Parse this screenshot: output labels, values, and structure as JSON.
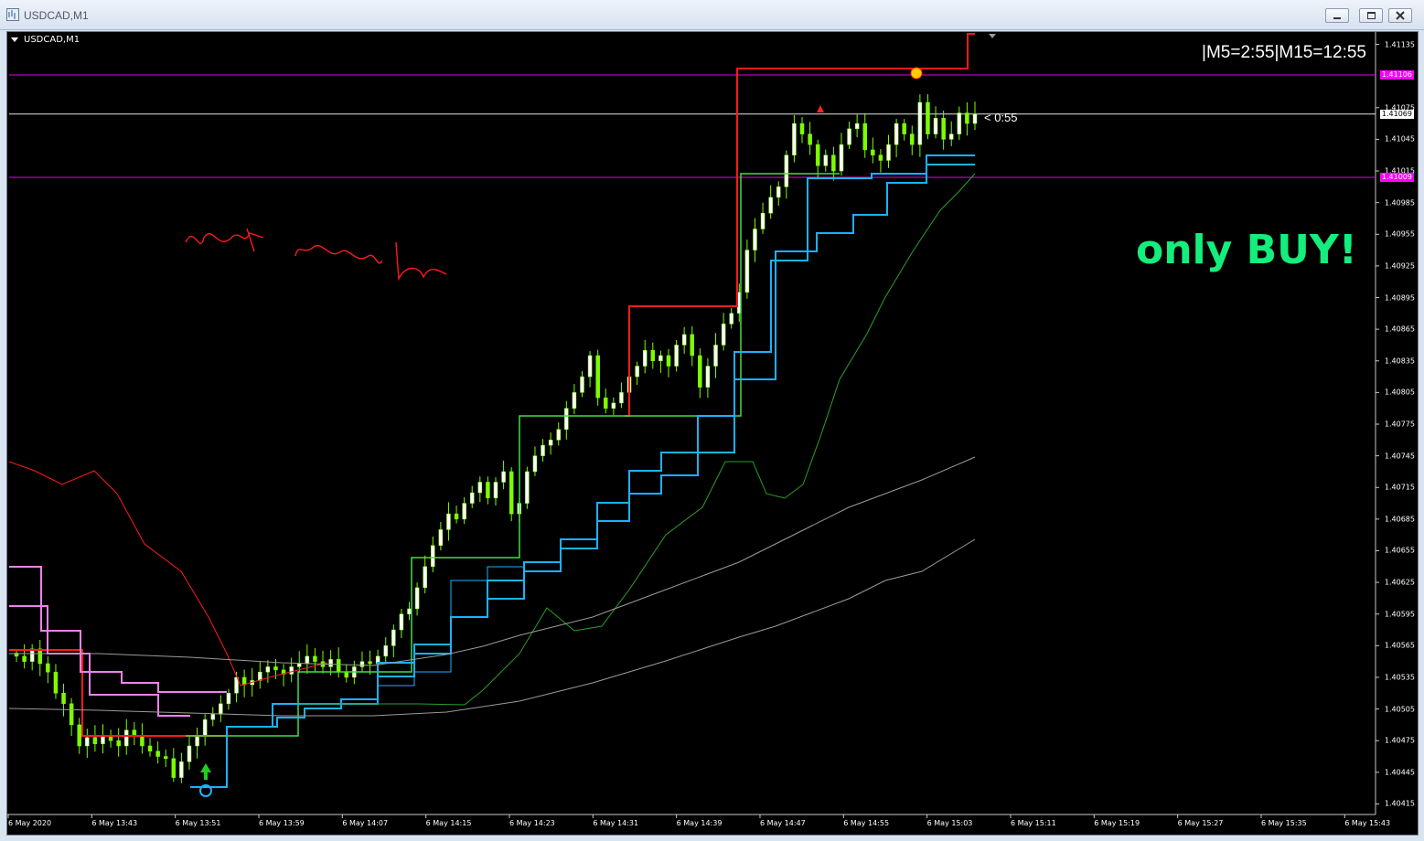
{
  "window": {
    "title": "USDCAD,M1",
    "symbol_label": "USDCAD,M1"
  },
  "overlay": {
    "timer": "|M5=2:55|M15=12:55",
    "countdown": "< 0:55",
    "signal_text": "only BUY!",
    "handwritten_note": "next 15min bar"
  },
  "price_axis": {
    "ticks": [
      "1.41135",
      "1.41075",
      "1.41045",
      "1.41015",
      "1.40985",
      "1.40955",
      "1.40925",
      "1.40895",
      "1.40865",
      "1.40835",
      "1.40805",
      "1.40775",
      "1.40745",
      "1.40715",
      "1.40685",
      "1.40655",
      "1.40625",
      "1.40595",
      "1.40565",
      "1.40535",
      "1.40505",
      "1.40475",
      "1.40445",
      "1.40415"
    ],
    "marked_levels": [
      {
        "label": "1.41106",
        "color": "#ff00ff"
      },
      {
        "label": "1.41069",
        "color": "#ffffff"
      },
      {
        "label": "1.41009",
        "color": "#ff00ff"
      }
    ]
  },
  "time_axis": {
    "ticks": [
      "6 May 2020",
      "6 May 13:43",
      "6 May 13:51",
      "6 May 13:59",
      "6 May 14:07",
      "6 May 14:15",
      "6 May 14:23",
      "6 May 14:31",
      "6 May 14:39",
      "6 May 14:47",
      "6 May 14:55",
      "6 May 15:03",
      "6 May 15:11",
      "6 May 15:19",
      "6 May 15:27",
      "6 May 15:35",
      "6 May 15:43"
    ]
  },
  "colors": {
    "candle_bull": "#ffffff",
    "candle_bear": "#7cfc00",
    "magenta_level": "#ff00ff",
    "red_line": "#ff1a1a",
    "blue_line": "#1ab2ff",
    "green_line": "#44dd44",
    "buy_text": "#13ee7c"
  },
  "chart_data": {
    "type": "candlestick",
    "symbol": "USDCAD",
    "timeframe": "M1",
    "y_range": [
      1.40405,
      1.41145
    ],
    "closes": [
      1.40555,
      1.4055,
      1.40562,
      1.40548,
      1.4054,
      1.4052,
      1.4051,
      1.4049,
      1.4047,
      1.40478,
      1.40472,
      1.4048,
      1.40475,
      1.4047,
      1.40485,
      1.4048,
      1.4047,
      1.40465,
      1.4046,
      1.40458,
      1.4044,
      1.40455,
      1.4047,
      1.4048,
      1.40495,
      1.405,
      1.4051,
      1.4052,
      1.40535,
      1.40528,
      1.40532,
      1.4054,
      1.40545,
      1.40542,
      1.40538,
      1.40545,
      1.40548,
      1.40555,
      1.4055,
      1.40545,
      1.40552,
      1.4054,
      1.40535,
      1.40545,
      1.4055,
      1.40548,
      1.40555,
      1.40565,
      1.4058,
      1.40595,
      1.406,
      1.4062,
      1.4064,
      1.4066,
      1.40675,
      1.4069,
      1.40685,
      1.407,
      1.4071,
      1.4072,
      1.40705,
      1.4072,
      1.4073,
      1.4069,
      1.407,
      1.4073,
      1.40745,
      1.40755,
      1.4076,
      1.4077,
      1.4079,
      1.40805,
      1.4082,
      1.4084,
      1.408,
      1.4079,
      1.40795,
      1.40805,
      1.4082,
      1.4083,
      1.40845,
      1.40835,
      1.4084,
      1.4083,
      1.4085,
      1.4086,
      1.4084,
      1.4081,
      1.4083,
      1.4085,
      1.4087,
      1.4088,
      1.409,
      1.4094,
      1.4096,
      1.40975,
      1.4099,
      1.41,
      1.4103,
      1.4106,
      1.4105,
      1.4104,
      1.4102,
      1.4103,
      1.41015,
      1.4104,
      1.41055,
      1.4106,
      1.41035,
      1.4103,
      1.41025,
      1.4104,
      1.4106,
      1.4105,
      1.4104,
      1.4108,
      1.4105,
      1.41065,
      1.41045,
      1.4105,
      1.4107,
      1.4106,
      1.41069
    ]
  }
}
